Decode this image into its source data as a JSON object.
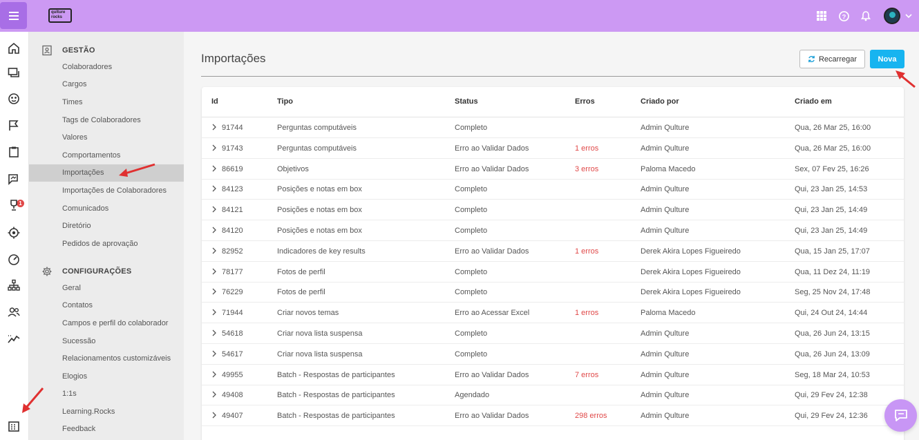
{
  "app": {
    "logo_text": "qulture rocks"
  },
  "topbar": {
    "icons": [
      "apps-grid-icon",
      "help-icon",
      "bell-icon",
      "user-avatar",
      "chevron-down-icon"
    ]
  },
  "rail": {
    "icons": [
      "home-icon",
      "chat-icon",
      "compass-icon",
      "flag-icon",
      "clipboard-icon",
      "feedback-icon",
      "trophy-icon",
      "target-icon",
      "gauge-icon",
      "org-chart-icon",
      "people-icon",
      "trend-icon",
      "building-icon"
    ],
    "notification_count": "1"
  },
  "sidebar": {
    "gestao_title": "GESTÃO",
    "gestao_items": [
      "Colaboradores",
      "Cargos",
      "Times",
      "Tags de Colaboradores",
      "Valores",
      "Comportamentos",
      "Importações",
      "Importações de Colaboradores",
      "Comunicados",
      "Diretório",
      "Pedidos de aprovação"
    ],
    "config_title": "CONFIGURAÇÕES",
    "config_items": [
      "Geral",
      "Contatos",
      "Campos e perfil do colaborador",
      "Sucessão",
      "Relacionamentos customizáveis",
      "Elogios",
      "1:1s",
      "Learning.Rocks",
      "Feedback"
    ],
    "active_item": "Importações"
  },
  "main": {
    "title": "Importações",
    "reload_label": "Recarregar",
    "new_label": "Nova",
    "columns": [
      "Id",
      "Tipo",
      "Status",
      "Erros",
      "Criado por",
      "Criado em"
    ],
    "rows": [
      {
        "id": "91744",
        "tipo": "Perguntas computáveis",
        "status": "Completo",
        "erros": "",
        "criado_por": "Admin Qulture",
        "criado_em": "Qua, 26 Mar 25, 16:00"
      },
      {
        "id": "91743",
        "tipo": "Perguntas computáveis",
        "status": "Erro ao Validar Dados",
        "erros": "1 erros",
        "criado_por": "Admin Qulture",
        "criado_em": "Qua, 26 Mar 25, 16:00"
      },
      {
        "id": "86619",
        "tipo": "Objetivos",
        "status": "Erro ao Validar Dados",
        "erros": "3 erros",
        "criado_por": "Paloma Macedo",
        "criado_em": "Sex, 07 Fev 25, 16:26"
      },
      {
        "id": "84123",
        "tipo": "Posições e notas em box",
        "status": "Completo",
        "erros": "",
        "criado_por": "Admin Qulture",
        "criado_em": "Qui, 23 Jan 25, 14:53"
      },
      {
        "id": "84121",
        "tipo": "Posições e notas em box",
        "status": "Completo",
        "erros": "",
        "criado_por": "Admin Qulture",
        "criado_em": "Qui, 23 Jan 25, 14:49"
      },
      {
        "id": "84120",
        "tipo": "Posições e notas em box",
        "status": "Completo",
        "erros": "",
        "criado_por": "Admin Qulture",
        "criado_em": "Qui, 23 Jan 25, 14:49"
      },
      {
        "id": "82952",
        "tipo": "Indicadores de key results",
        "status": "Erro ao Validar Dados",
        "erros": "1 erros",
        "criado_por": "Derek Akira Lopes Figueiredo",
        "criado_em": "Qua, 15 Jan 25, 17:07"
      },
      {
        "id": "78177",
        "tipo": "Fotos de perfil",
        "status": "Completo",
        "erros": "",
        "criado_por": "Derek Akira Lopes Figueiredo",
        "criado_em": "Qua, 11 Dez 24, 11:19"
      },
      {
        "id": "76229",
        "tipo": "Fotos de perfil",
        "status": "Completo",
        "erros": "",
        "criado_por": "Derek Akira Lopes Figueiredo",
        "criado_em": "Seg, 25 Nov 24, 17:48"
      },
      {
        "id": "71944",
        "tipo": "Criar novos temas",
        "status": "Erro ao Acessar Excel",
        "erros": "1 erros",
        "criado_por": "Paloma Macedo",
        "criado_em": "Qui, 24 Out 24, 14:44"
      },
      {
        "id": "54618",
        "tipo": "Criar nova lista suspensa",
        "status": "Completo",
        "erros": "",
        "criado_por": "Admin Qulture",
        "criado_em": "Qua, 26 Jun 24, 13:15"
      },
      {
        "id": "54617",
        "tipo": "Criar nova lista suspensa",
        "status": "Completo",
        "erros": "",
        "criado_por": "Admin Qulture",
        "criado_em": "Qua, 26 Jun 24, 13:09"
      },
      {
        "id": "49955",
        "tipo": "Batch - Respostas de participantes",
        "status": "Erro ao Validar Dados",
        "erros": "7 erros",
        "criado_por": "Admin Qulture",
        "criado_em": "Seg, 18 Mar 24, 10:53"
      },
      {
        "id": "49408",
        "tipo": "Batch - Respostas de participantes",
        "status": "Agendado",
        "erros": "",
        "criado_por": "Admin Qulture",
        "criado_em": "Qui, 29 Fev 24, 12:38"
      },
      {
        "id": "49407",
        "tipo": "Batch - Respostas de participantes",
        "status": "Erro ao Validar Dados",
        "erros": "298 erros",
        "criado_por": "Admin Qulture",
        "criado_em": "Qui, 29 Fev 24, 12:36"
      }
    ]
  },
  "colors": {
    "topbar": "#cc99f3",
    "accent_button": "#17b4f0",
    "error_text": "#e04848",
    "annotation_arrow": "#e03030"
  }
}
